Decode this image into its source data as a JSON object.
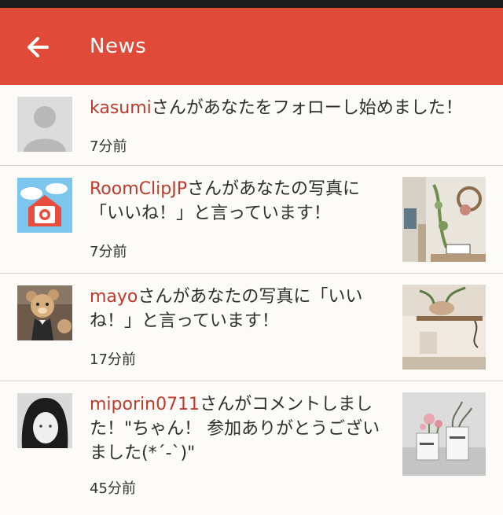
{
  "header": {
    "title": "News",
    "back_icon": "back-arrow-icon"
  },
  "colors": {
    "appbar": "#e04a38",
    "username": "#c0392b",
    "background": "#fcfbf7"
  },
  "notifications": [
    {
      "user": "kasumi",
      "message": "さんがあなたをフォローし始めました！",
      "time": "7分前",
      "avatar": "default-avatar-icon"
    },
    {
      "user": "RoomClipJP",
      "message": "さんがあなたの写真に「いいね！」と言っています！",
      "time": "7分前",
      "avatar": "roomclip-logo-icon"
    },
    {
      "user": "mayo",
      "message": "さんがあなたの写真に「いいね！」と言っています！",
      "time": "17分前",
      "avatar": "teddy-bear-photo"
    },
    {
      "user": "miporin0711",
      "message": "さんがコメントしました！\"ちゃん！ 参加ありがとうございました(*´-`)\"",
      "time": "45分前",
      "avatar": "user-photo"
    }
  ]
}
